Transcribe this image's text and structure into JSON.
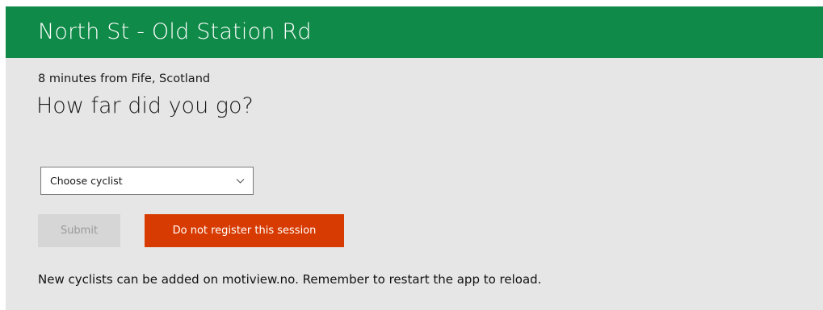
{
  "header": {
    "title": "North St - Old Station Rd",
    "background_color": "#0f8a48"
  },
  "trip": {
    "subtitle": "8 minutes from Fife, Scotland",
    "question": "How far did you go?"
  },
  "cyclist_select": {
    "selected": "Choose cyclist",
    "icon": "chevron-down-icon"
  },
  "actions": {
    "submit_label": "Submit",
    "skip_label": "Do not register this session",
    "skip_color": "#d83b01"
  },
  "footer": {
    "note": "New cyclists can be added on motiview.no. Remember to restart the app to reload."
  }
}
